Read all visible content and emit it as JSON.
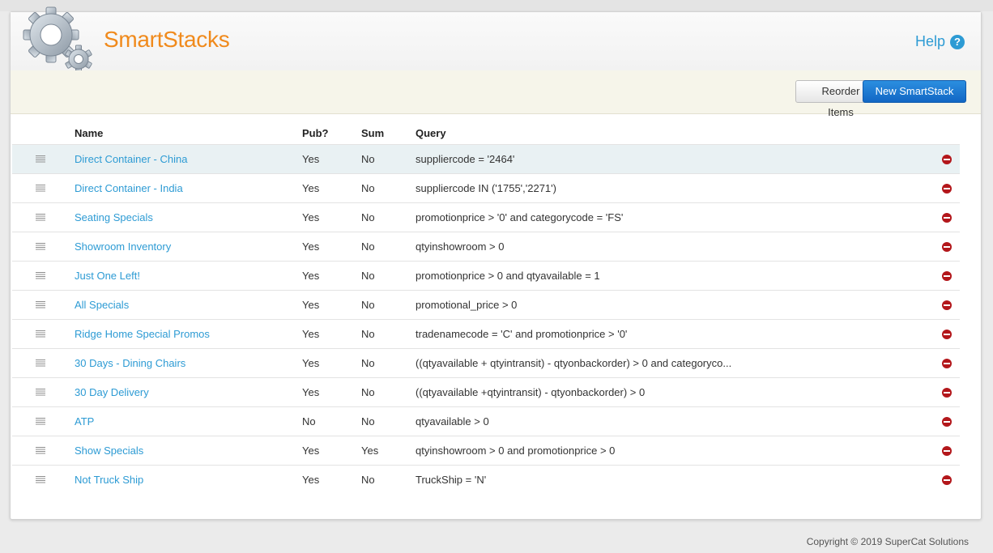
{
  "app": {
    "title": "SmartStacks",
    "help_label": "Help",
    "help_icon": "question-circle-icon"
  },
  "toolbar": {
    "reorder_label": "Reorder Items",
    "new_label": "New SmartStack"
  },
  "table": {
    "headers": {
      "name": "Name",
      "pub": "Pub?",
      "sum": "Sum",
      "query": "Query"
    },
    "rows": [
      {
        "name": "Direct Container - China",
        "pub": "Yes",
        "sum": "No",
        "query": "suppliercode = '2464'"
      },
      {
        "name": "Direct Container - India",
        "pub": "Yes",
        "sum": "No",
        "query": "suppliercode IN ('1755','2271')"
      },
      {
        "name": "Seating Specials",
        "pub": "Yes",
        "sum": "No",
        "query": "promotionprice > '0' and categorycode = 'FS'"
      },
      {
        "name": "Showroom Inventory",
        "pub": "Yes",
        "sum": "No",
        "query": "qtyinshowroom > 0"
      },
      {
        "name": "Just One Left!",
        "pub": "Yes",
        "sum": "No",
        "query": "promotionprice > 0 and qtyavailable = 1"
      },
      {
        "name": "All Specials",
        "pub": "Yes",
        "sum": "No",
        "query": "promotional_price > 0"
      },
      {
        "name": "Ridge Home Special Promos",
        "pub": "Yes",
        "sum": "No",
        "query": "tradenamecode = 'C' and promotionprice > '0'"
      },
      {
        "name": "30 Days - Dining Chairs",
        "pub": "Yes",
        "sum": "No",
        "query": "((qtyavailable + qtyintransit) - qtyonbackorder) > 0 and categoryco..."
      },
      {
        "name": "30 Day Delivery",
        "pub": "Yes",
        "sum": "No",
        "query": "((qtyavailable +qtyintransit) - qtyonbackorder) > 0"
      },
      {
        "name": "ATP",
        "pub": "No",
        "sum": "No",
        "query": "qtyavailable > 0"
      },
      {
        "name": "Show Specials",
        "pub": "Yes",
        "sum": "Yes",
        "query": "qtyinshowroom > 0 and promotionprice > 0"
      },
      {
        "name": "Not Truck Ship",
        "pub": "Yes",
        "sum": "No",
        "query": "TruckShip = 'N'"
      }
    ]
  },
  "footer": {
    "copyright": "Copyright © 2019 SuperCat Solutions"
  },
  "colors": {
    "brand": "#f08a1c",
    "link": "#2d9bd4",
    "primary_button": "#1a73d1",
    "delete": "#b3171b"
  }
}
